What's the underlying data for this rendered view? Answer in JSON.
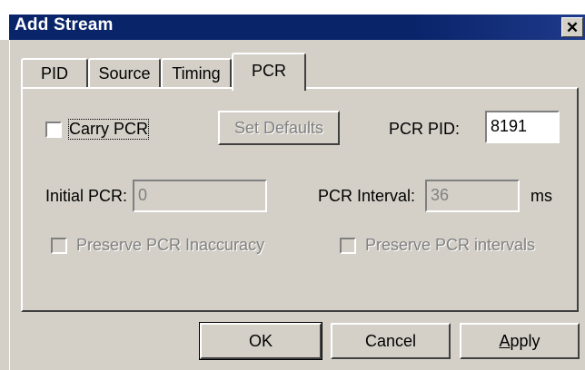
{
  "window": {
    "title": "Add Stream",
    "close_glyph": "✕"
  },
  "tabs": [
    {
      "label": "PID",
      "active": false
    },
    {
      "label": "Source",
      "active": false
    },
    {
      "label": "Timing",
      "active": false
    },
    {
      "label": "PCR",
      "active": true
    }
  ],
  "pcr": {
    "carry_pcr_label": "Carry PCR",
    "carry_pcr_checked": false,
    "set_defaults_label": "Set Defaults",
    "pcr_pid_label": "PCR PID:",
    "pcr_pid_value": "8191",
    "initial_pcr_label": "Initial PCR:",
    "initial_pcr_value": "0",
    "pcr_interval_label": "PCR Interval:",
    "pcr_interval_value": "36",
    "pcr_interval_unit": "ms",
    "preserve_inaccuracy_label": "Preserve PCR Inaccuracy",
    "preserve_intervals_label": "Preserve PCR intervals"
  },
  "buttons": {
    "ok_label": "OK",
    "cancel_label": "Cancel",
    "apply_label": "Apply"
  }
}
